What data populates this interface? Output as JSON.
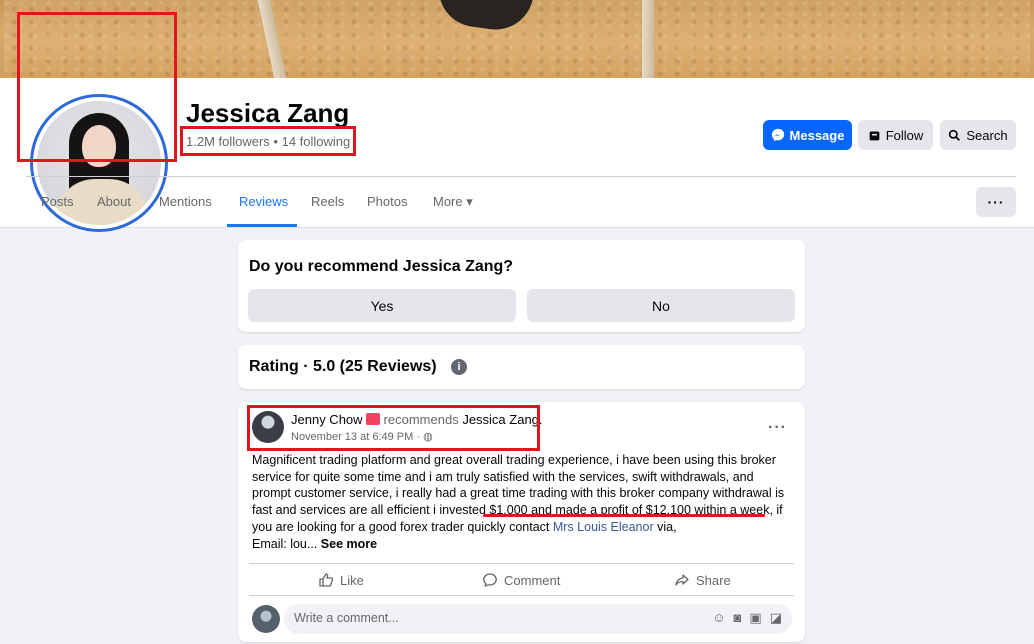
{
  "profile": {
    "name": "Jessica Zang",
    "followers_line": "1.2M followers • 14 following"
  },
  "actions": {
    "message": "Message",
    "follow": "Follow",
    "search": "Search"
  },
  "tabs": [
    {
      "label": "Posts"
    },
    {
      "label": "About"
    },
    {
      "label": "Mentions"
    },
    {
      "label": "Reviews",
      "active": true
    },
    {
      "label": "Reels"
    },
    {
      "label": "Photos"
    },
    {
      "label": "More ▾"
    }
  ],
  "recommend": {
    "question": "Do you recommend Jessica Zang?",
    "yes": "Yes",
    "no": "No"
  },
  "rating": {
    "text": "Rating · 5.0 (25 Reviews)"
  },
  "post": {
    "author": "Jenny Chow",
    "verb": "recommends",
    "target": "Jessica Zang.",
    "time": "November 13 at 6:49 PM · ",
    "body_1": "Magnificent trading platform and great overall trading experience, i have been using this broker service for quite some time and i am truly satisfied with the services, swift withdrawals, and prompt customer service, i really had a great time trading with this broker company withdrawal is fast and services are all efficient i invested $1,000 and made a profit of $12,100 within a week, if you are looking for a good forex trader quickly contact ",
    "body_link": "Mrs Louis Eleanor",
    "body_2": " via,",
    "body_3": "Email: lou... ",
    "see_more": "See more",
    "like": "Like",
    "comment": "Comment",
    "share": "Share",
    "comment_placeholder": "Write a comment..."
  },
  "colors": {
    "accent": "#1877f2",
    "highlight_box": "#e0161f"
  }
}
